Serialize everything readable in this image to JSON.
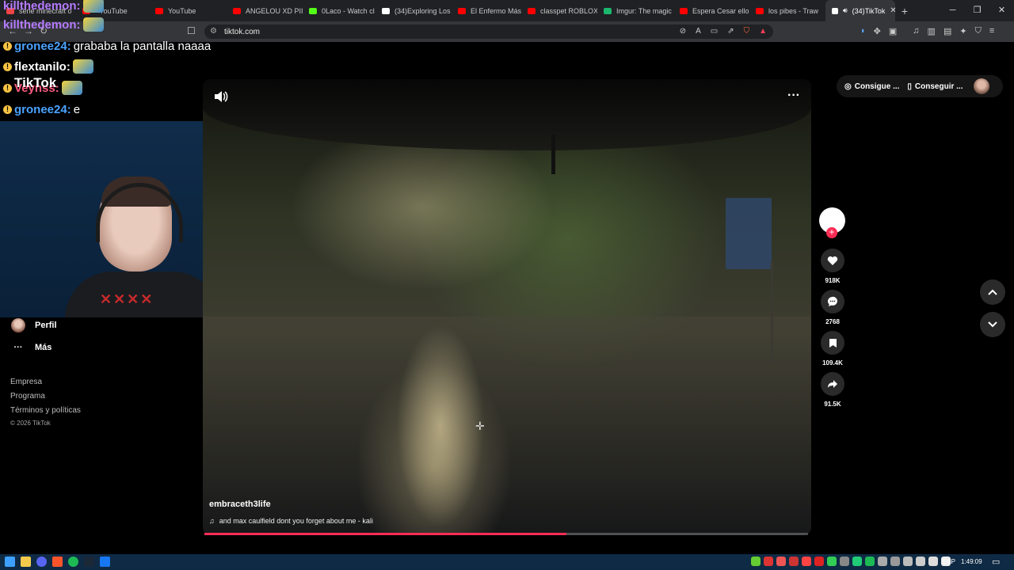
{
  "browser": {
    "tabs": [
      {
        "title": "serie minecraft o",
        "color": "#e44"
      },
      {
        "title": "- YouTube",
        "color": "#f00"
      },
      {
        "title": "YouTube",
        "color": "#f00"
      },
      {
        "title": "ANGELOU XD PII",
        "color": "#f00"
      },
      {
        "title": "0Laco - Watch cl",
        "color": "#53fc18"
      },
      {
        "title": "(34)Exploring Los",
        "color": "#fff"
      },
      {
        "title": "El Enfermo Más",
        "color": "#f00"
      },
      {
        "title": "classpet ROBLOX",
        "color": "#f00"
      },
      {
        "title": "Imgur: The magic",
        "color": "#1bb76e"
      },
      {
        "title": "Espera Cesar ello",
        "color": "#f00"
      },
      {
        "title": "los pibes - Traw",
        "color": "#f00"
      }
    ],
    "active_tab": {
      "title": "(34)TikTok",
      "close": "✕"
    },
    "new_tab": "+",
    "window_controls": {
      "minimize": "─",
      "maximize": "❐",
      "close": "✕"
    },
    "url": "tiktok.com"
  },
  "chat": [
    {
      "user": "killthedemon:",
      "color": "#b57bff",
      "message": ""
    },
    {
      "user": "killthedemon:",
      "color": "#b57bff",
      "message": ""
    },
    {
      "user": "gronee24:",
      "color": "#4aa3ff",
      "message": "grababa la pantalla naaaa"
    },
    {
      "user": "flextanilo:",
      "color": "#ffffff",
      "message": ""
    },
    {
      "user": "Veynss:",
      "color": "#ff5b7f",
      "message": ""
    },
    {
      "user": "gronee24:",
      "color": "#4aa3ff",
      "message": "e"
    }
  ],
  "tiktok_mark": "TikTok",
  "sidebar": {
    "profile": "Perfil",
    "more": "Más",
    "links": [
      "Empresa",
      "Programa",
      "Términos y políticas"
    ],
    "copyright": "© 2026 TikTok"
  },
  "video": {
    "author": "embraceth3life",
    "music": "and max caulfield dont you forget about me - kali",
    "progress": 0.6
  },
  "actions": {
    "likes": "918K",
    "comments": "2768",
    "saves": "109.4K",
    "shares": "91.5K"
  },
  "top_buttons": {
    "coins": "Consigue ...",
    "app": "Conseguir ..."
  },
  "taskbar": {
    "language": "ESP",
    "time": "1:49:09"
  }
}
